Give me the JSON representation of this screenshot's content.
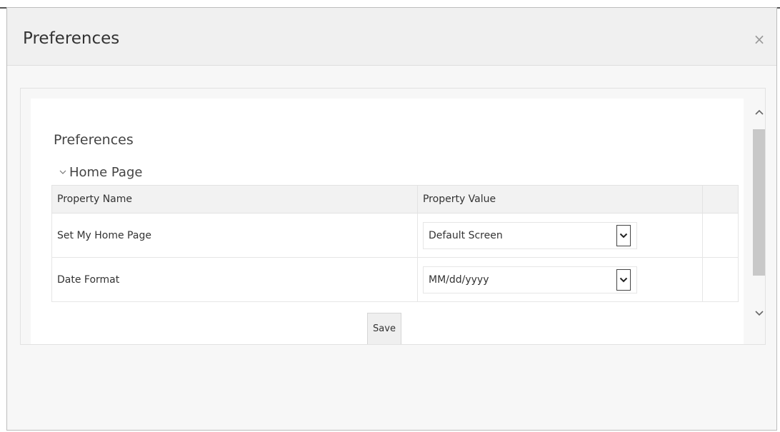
{
  "dialog": {
    "title": "Preferences"
  },
  "panel": {
    "section_title": "Preferences",
    "group_label": "Home Page",
    "table": {
      "headers": [
        "Property Name",
        "Property Value"
      ],
      "rows": [
        {
          "name": "Set My Home Page",
          "value": "Default Screen"
        },
        {
          "name": "Date Format",
          "value": "MM/dd/yyyy"
        }
      ]
    },
    "save_label": "Save"
  },
  "icons": {
    "close": "close-icon",
    "group_toggle": "chevron-down-icon",
    "select_arrow": "chevron-down-icon",
    "scroll_up": "chevron-up-icon",
    "scroll_down": "chevron-down-icon"
  },
  "colors": {
    "header_bg": "#f0f0f0",
    "table_header_bg": "#f2f2f2",
    "scroll_thumb": "#c8c8c8"
  }
}
